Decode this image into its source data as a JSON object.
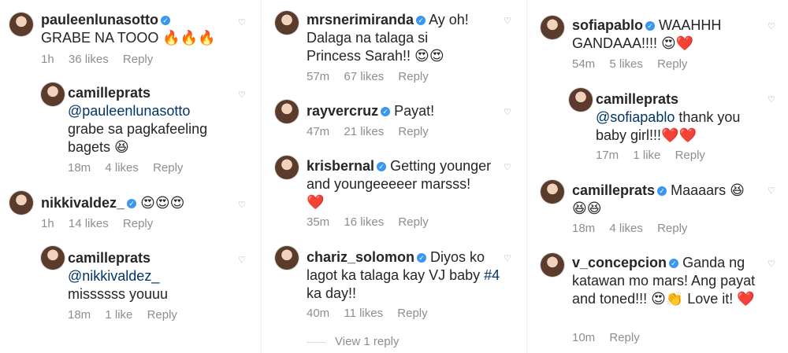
{
  "col1": [
    {
      "user": "pauleenlunasotto",
      "text": "GRABE NA TOOO 🔥🔥🔥",
      "time": "1h",
      "likes": "36 likes",
      "reply": "Reply"
    },
    {
      "user": "camilleprats",
      "mention": "@pauleenlunasotto",
      "text": "grabe sa pagkafeeling bagets 😆",
      "time": "18m",
      "likes": "4 likes",
      "reply": "Reply"
    },
    {
      "user": "nikkivaldez_",
      "text": "😍😍😍",
      "time": "1h",
      "likes": "14 likes",
      "reply": "Reply"
    },
    {
      "user": "camilleprats",
      "mention": "@nikkivaldez_",
      "text": "missssss youuu",
      "time": "18m",
      "likes": "1 like",
      "reply": "Reply"
    }
  ],
  "col2": [
    {
      "user": "mrsnerimiranda",
      "text": "Ay oh! Dalaga na talaga si Princess Sarah!! 😍😍",
      "time": "57m",
      "likes": "67 likes",
      "reply": "Reply"
    },
    {
      "user": "rayvercruz",
      "text": "Payat!",
      "time": "47m",
      "likes": "21 likes",
      "reply": "Reply"
    },
    {
      "user": "krisbernal",
      "text": "Getting younger and youngeeeeer marsss! ❤️",
      "time": "35m",
      "likes": "16 likes",
      "reply": "Reply"
    },
    {
      "user": "chariz_solomon",
      "text": "Diyos ko lagot ka talaga kay VJ baby",
      "hashtag": "#4",
      "text2": "ka day!!",
      "time": "40m",
      "likes": "11 likes",
      "reply": "Reply"
    }
  ],
  "view_reply": "View 1 reply",
  "col3": [
    {
      "user": "sofiapablo",
      "text": "WAAHHH GANDAAA!!!! 😍❤️",
      "time": "54m",
      "likes": "5 likes",
      "reply": "Reply"
    },
    {
      "user": "camilleprats",
      "mention": "@sofiapablo",
      "text": "thank you baby girl!!!❤️❤️",
      "time": "17m",
      "likes": "1 like",
      "reply": "Reply"
    },
    {
      "user": "camilleprats",
      "text": "Maaaars 😆😆😆",
      "time": "18m",
      "likes": "4 likes",
      "reply": "Reply"
    },
    {
      "user": "v_concepcion",
      "text": "Ganda ng katawan mo mars! Ang payat and toned!!! 😍👏 Love it! ❤️",
      "time": "10m",
      "likes": "",
      "reply": "Reply"
    }
  ]
}
